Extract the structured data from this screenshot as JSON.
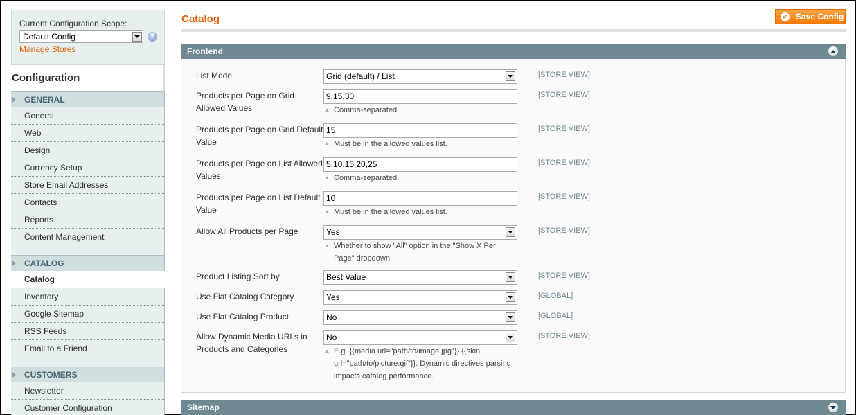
{
  "sidebar": {
    "scope_label": "Current Configuration Scope:",
    "scope_value": "Default Config",
    "help_icon": "?",
    "manage_stores": "Manage Stores",
    "title": "Configuration",
    "groups": [
      {
        "label": "GENERAL",
        "items": [
          "General",
          "Web",
          "Design",
          "Currency Setup",
          "Store Email Addresses",
          "Contacts",
          "Reports",
          "Content Management"
        ]
      },
      {
        "label": "CATALOG",
        "active": "Catalog",
        "items": [
          "Inventory",
          "Google Sitemap",
          "RSS Feeds",
          "Email to a Friend"
        ]
      },
      {
        "label": "CUSTOMERS",
        "items": [
          "Newsletter",
          "Customer Configuration"
        ]
      }
    ]
  },
  "main": {
    "title": "Catalog",
    "save_label": "Save Config",
    "accent": "#eb5e00",
    "sections": [
      {
        "title": "Frontend",
        "expanded": true,
        "fields": [
          {
            "label": "List Mode",
            "type": "select",
            "value": "Grid (default) / List",
            "scope": "[STORE VIEW]"
          },
          {
            "label": "Products per Page on Grid Allowed Values",
            "type": "text",
            "value": "9,15,30",
            "note": "Comma-separated.",
            "scope": "[STORE VIEW]"
          },
          {
            "label": "Products per Page on Grid Default Value",
            "type": "text",
            "value": "15",
            "note": "Must be in the allowed values list.",
            "scope": "[STORE VIEW]"
          },
          {
            "label": "Products per Page on List Allowed Values",
            "type": "text",
            "value": "5,10,15,20,25",
            "note": "Comma-separated.",
            "scope": "[STORE VIEW]"
          },
          {
            "label": "Products per Page on List Default Value",
            "type": "text",
            "value": "10",
            "note": "Must be in the allowed values list.",
            "scope": "[STORE VIEW]"
          },
          {
            "label": "Allow All Products per Page",
            "type": "select",
            "value": "Yes",
            "note": "Whether to show \"All\" option in the \"Show X Per Page\" dropdown.",
            "scope": "[STORE VIEW]"
          },
          {
            "label": "Product Listing Sort by",
            "type": "select",
            "value": "Best Value",
            "scope": "[STORE VIEW]"
          },
          {
            "label": "Use Flat Catalog Category",
            "type": "select",
            "value": "Yes",
            "scope": "[GLOBAL]"
          },
          {
            "label": "Use Flat Catalog Product",
            "type": "select",
            "value": "No",
            "scope": "[GLOBAL]"
          },
          {
            "label": "Allow Dynamic Media URLs in Products and Categories",
            "type": "select",
            "value": "No",
            "note": "E.g. {{media url=\"path/to/image.jpg\"}} {{skin url=\"path/to/picture.gif\"}}. Dynamic directives parsing impacts catalog performance.",
            "scope": "[STORE VIEW]"
          }
        ]
      },
      {
        "title": "Sitemap",
        "expanded": false
      }
    ]
  }
}
